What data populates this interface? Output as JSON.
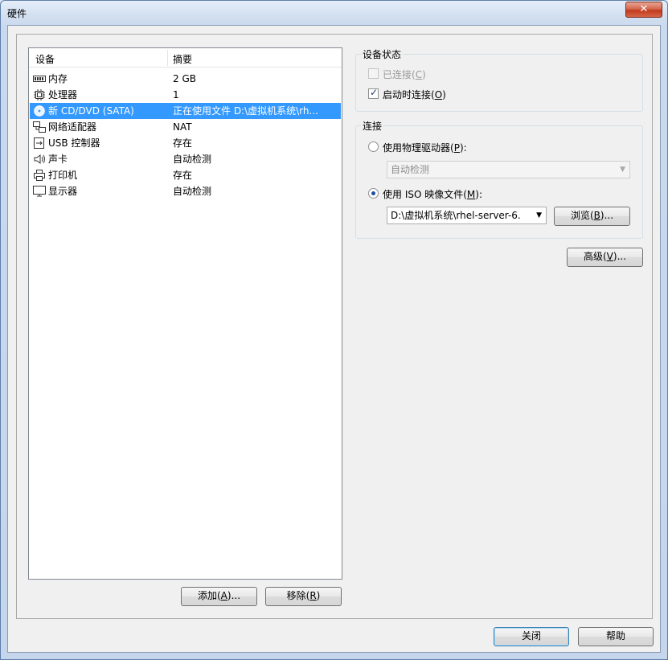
{
  "window": {
    "title": "硬件",
    "close_glyph": "✕"
  },
  "device_list": {
    "columns": {
      "device": "设备",
      "summary": "摘要"
    },
    "rows": [
      {
        "icon": "memory-icon",
        "name": "内存",
        "summary": "2 GB"
      },
      {
        "icon": "processor-icon",
        "name": "处理器",
        "summary": "1"
      },
      {
        "icon": "cd-dvd-icon",
        "name": "新 CD/DVD (SATA)",
        "summary": "正在使用文件 D:\\虚拟机系统\\rh...",
        "selected": true
      },
      {
        "icon": "network-adapter-icon",
        "name": "网络适配器",
        "summary": "NAT"
      },
      {
        "icon": "usb-icon",
        "name": "USB 控制器",
        "summary": "存在"
      },
      {
        "icon": "sound-card-icon",
        "name": "声卡",
        "summary": "自动检测"
      },
      {
        "icon": "printer-icon",
        "name": "打印机",
        "summary": "存在"
      },
      {
        "icon": "display-icon",
        "name": "显示器",
        "summary": "自动检测"
      }
    ],
    "add_button": {
      "label": "添加",
      "mnemonic": "A",
      "suffix": ")..."
    },
    "remove_button": {
      "label": "移除",
      "mnemonic": "R",
      "suffix": ")"
    }
  },
  "device_status": {
    "title": "设备状态",
    "connected": {
      "label": "已连接",
      "mnemonic": "C",
      "checked": false,
      "enabled": false
    },
    "connect_at_power_on": {
      "label": "启动时连接",
      "mnemonic": "O",
      "checked": true,
      "enabled": true
    }
  },
  "connection": {
    "title": "连接",
    "physical_drive": {
      "label": "使用物理驱动器",
      "mnemonic": "P",
      "selected": false,
      "dropdown_value": "自动检测"
    },
    "iso_file": {
      "label": "使用 ISO 映像文件",
      "mnemonic": "M",
      "selected": true,
      "path_value": "D:\\虚拟机系统\\rhel-server-6."
    },
    "browse_button": {
      "label": "浏览",
      "mnemonic": "B",
      "suffix": ")..."
    }
  },
  "advanced_button": {
    "label": "高级",
    "mnemonic": "V",
    "suffix": ")..."
  },
  "footer": {
    "close_button": "关闭",
    "help_button": "帮助"
  },
  "colors": {
    "selection": "#3399ff",
    "title_close": "#c2391c"
  }
}
